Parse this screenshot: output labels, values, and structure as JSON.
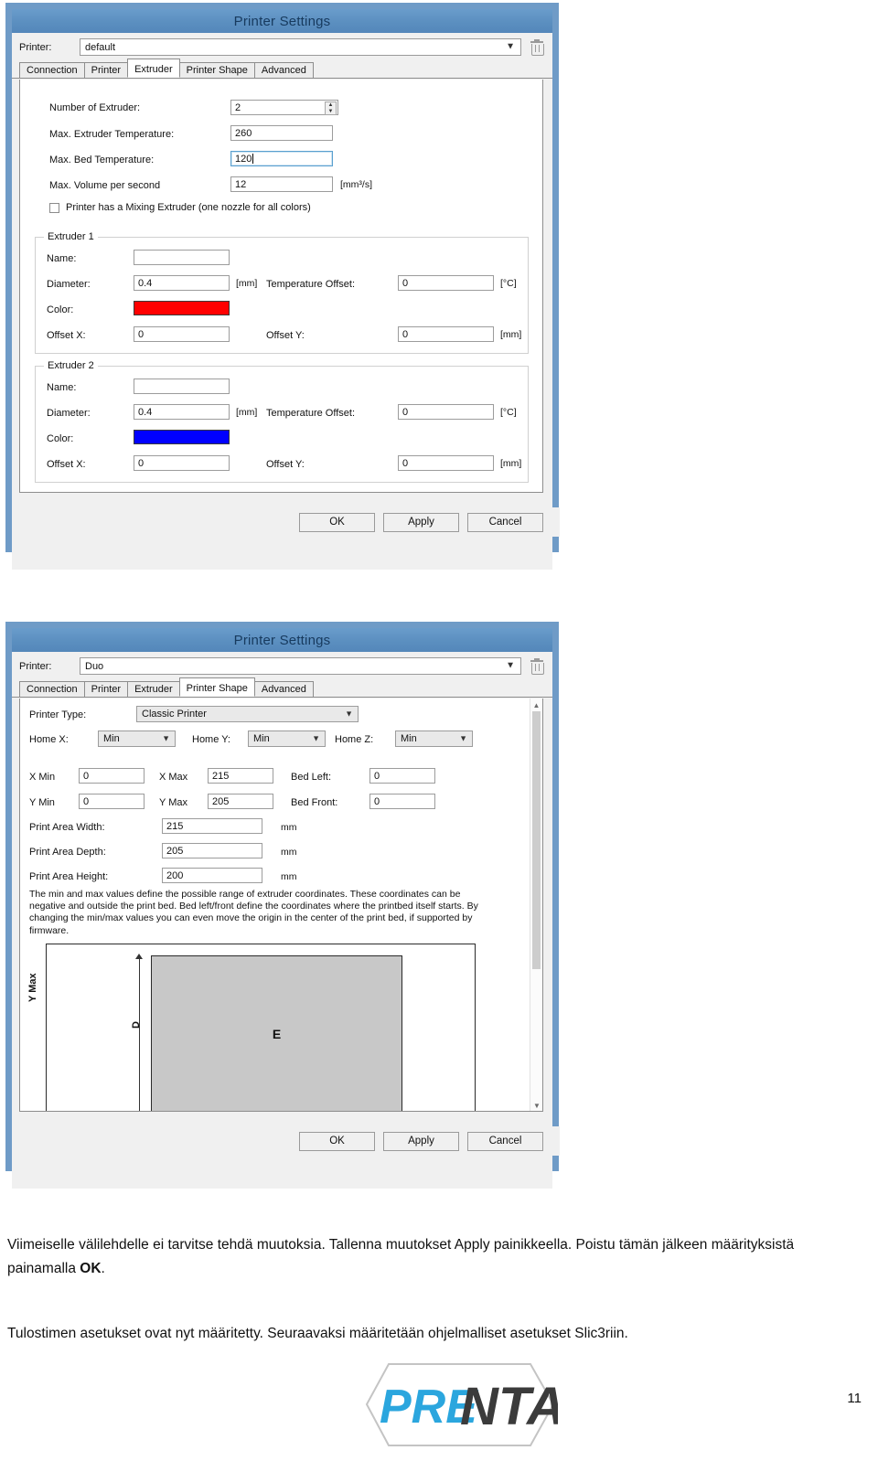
{
  "document": {
    "page_number": "11",
    "paragraphs": [
      {
        "id": "p1",
        "part1": "Viimeiselle välilehdelle ei tarvitse tehdä muutoksia. Tallenna muutokset Apply painikkeella. Poistu tämän jälkeen määrityksistä painamalla ",
        "bold": "OK",
        "part2": "."
      },
      {
        "id": "p2",
        "text": "Tulostimen asetukset ovat nyt määritetty. Seuraavaksi määritetään ohjelmalliset asetukset Slic3riin."
      }
    ],
    "logo": {
      "text_light": "PRE",
      "text_dark": "NTA",
      "accent_color": "#2ba6de",
      "dark_color": "#3b3b3b"
    }
  },
  "dialog1": {
    "title": "Printer Settings",
    "printer_label": "Printer:",
    "printer_value": "default",
    "delete_icon": "trash-icon",
    "tabs": [
      {
        "label": "Connection",
        "active": false
      },
      {
        "label": "Printer",
        "active": false
      },
      {
        "label": "Extruder",
        "active": true
      },
      {
        "label": "Printer Shape",
        "active": false
      },
      {
        "label": "Advanced",
        "active": false
      }
    ],
    "fields": [
      {
        "label": "Number of Extruder:",
        "value": "2",
        "unit": "",
        "type": "spinner"
      },
      {
        "label": "Max. Extruder Temperature:",
        "value": "260",
        "unit": "",
        "type": "text"
      },
      {
        "label": "Max. Bed Temperature:",
        "value": "120",
        "unit": "",
        "type": "text",
        "focused": true
      },
      {
        "label": "Max. Volume per second",
        "value": "12",
        "unit": "[mm³/s]",
        "type": "text"
      }
    ],
    "mixing_checkbox": {
      "label": "Printer has a Mixing Extruder (one nozzle for all colors)",
      "checked": false
    },
    "extruders": [
      {
        "title": "Extruder 1",
        "name_label": "Name:",
        "name_value": "",
        "diameter_label": "Diameter:",
        "diameter_value": "0.4",
        "diameter_unit": "[mm]",
        "temp_offset_label": "Temperature Offset:",
        "temp_offset_value": "0",
        "temp_offset_unit": "[°C]",
        "color_label": "Color:",
        "color_value": "#ff0000",
        "offset_x_label": "Offset X:",
        "offset_x_value": "0",
        "offset_y_label": "Offset Y:",
        "offset_y_value": "0",
        "offset_unit": "[mm]"
      },
      {
        "title": "Extruder 2",
        "name_label": "Name:",
        "name_value": "",
        "diameter_label": "Diameter:",
        "diameter_value": "0.4",
        "diameter_unit": "[mm]",
        "temp_offset_label": "Temperature Offset:",
        "temp_offset_value": "0",
        "temp_offset_unit": "[°C]",
        "color_label": "Color:",
        "color_value": "#0000ff",
        "offset_x_label": "Offset X:",
        "offset_x_value": "0",
        "offset_y_label": "Offset Y:",
        "offset_y_value": "0",
        "offset_unit": "[mm]"
      }
    ],
    "buttons": {
      "ok": "OK",
      "apply": "Apply",
      "cancel": "Cancel"
    }
  },
  "dialog2": {
    "title": "Printer Settings",
    "printer_label": "Printer:",
    "printer_value": "Duo",
    "delete_icon": "trash-icon",
    "tabs": [
      {
        "label": "Connection",
        "active": false
      },
      {
        "label": "Printer",
        "active": false
      },
      {
        "label": "Extruder",
        "active": false
      },
      {
        "label": "Printer Shape",
        "active": true
      },
      {
        "label": "Advanced",
        "active": false
      }
    ],
    "printer_type": {
      "label": "Printer Type:",
      "value": "Classic Printer"
    },
    "homes": [
      {
        "label": "Home X:",
        "value": "Min"
      },
      {
        "label": "Home Y:",
        "value": "Min"
      },
      {
        "label": "Home Z:",
        "value": "Min"
      }
    ],
    "minmax": [
      {
        "label": "X Min",
        "value": "0"
      },
      {
        "label": "X Max",
        "value": "215"
      },
      {
        "label": "Bed Left:",
        "value": "0"
      },
      {
        "label": "Y Min",
        "value": "0"
      },
      {
        "label": "Y Max",
        "value": "205"
      },
      {
        "label": "Bed Front:",
        "value": "0"
      }
    ],
    "areas": [
      {
        "label": "Print Area Width:",
        "value": "215",
        "unit": "mm"
      },
      {
        "label": "Print Area Depth:",
        "value": "205",
        "unit": "mm"
      },
      {
        "label": "Print Area Height:",
        "value": "200",
        "unit": "mm"
      }
    ],
    "description": "The min and max values define the possible range of extruder coordinates. These coordinates can be negative and outside the print bed. Bed left/front define the coordinates where the printbed itself starts. By changing the min/max values you can even move the origin in the center of the print bed, if supported by firmware.",
    "preview": {
      "y_axis_label": "Y Max",
      "depth_label": "D",
      "bed_label": "E"
    },
    "buttons": {
      "ok": "OK",
      "apply": "Apply",
      "cancel": "Cancel"
    }
  }
}
